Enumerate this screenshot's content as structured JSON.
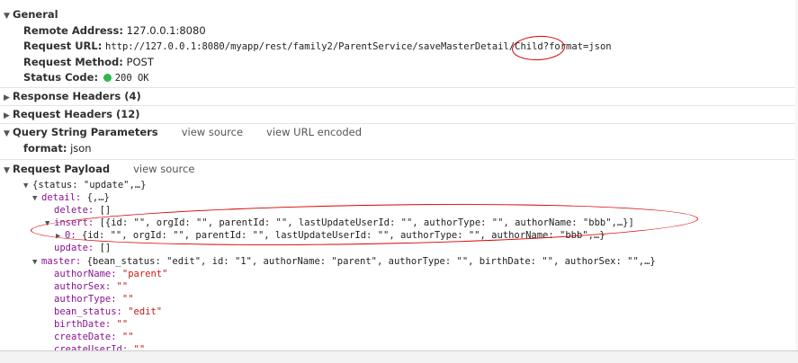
{
  "general": {
    "title": "General",
    "remote_address_label": "Remote Address:",
    "remote_address": "127.0.0.1:8080",
    "request_url_label": "Request URL:",
    "request_url": "http://127.0.0.1:8080/myapp/rest/family2/ParentService/saveMasterDetail/Child?format=json",
    "request_method_label": "Request Method:",
    "request_method": "POST",
    "status_code_label": "Status Code:",
    "status_code": "200 OK",
    "status_color": "#2db94d"
  },
  "response_headers": {
    "title": "Response Headers (4)"
  },
  "request_headers": {
    "title": "Request Headers (12)"
  },
  "query_string": {
    "title": "Query String Parameters",
    "view_source": "view source",
    "view_url_encoded": "view URL encoded",
    "param_key": "format:",
    "param_value": "json"
  },
  "payload": {
    "title": "Request Payload",
    "view_source": "view source",
    "root_summary": "{status: \"update\",…}",
    "detail_key": "detail:",
    "detail_summary": "{,…}",
    "delete_key": "delete:",
    "delete_value": "[]",
    "insert_key": "insert:",
    "insert_summary": "[{id: \"\", orgId: \"\", parentId: \"\", lastUpdateUserId: \"\", authorType: \"\", authorName: \"bbb\",…}]",
    "insert_item_key": "0:",
    "insert_item_summary": "{id: \"\", orgId: \"\", parentId: \"\", lastUpdateUserId: \"\", authorType: \"\", authorName: \"bbb\",…}",
    "update_key": "update:",
    "update_value": "[]",
    "master_key": "master:",
    "master_summary": "{bean_status: \"edit\", id: \"1\", authorName: \"parent\", authorType: \"\", birthDate: \"\", authorSex: \"\",…}",
    "master_fields": [
      {
        "key": "authorName:",
        "value": "\"parent\""
      },
      {
        "key": "authorSex:",
        "value": "\"\""
      },
      {
        "key": "authorType:",
        "value": "\"\""
      },
      {
        "key": "bean_status:",
        "value": "\"edit\""
      },
      {
        "key": "birthDate:",
        "value": "\"\""
      },
      {
        "key": "createDate:",
        "value": "\"\""
      },
      {
        "key": "createUserId:",
        "value": "\"\""
      }
    ]
  },
  "annotation_color": "#d90000"
}
